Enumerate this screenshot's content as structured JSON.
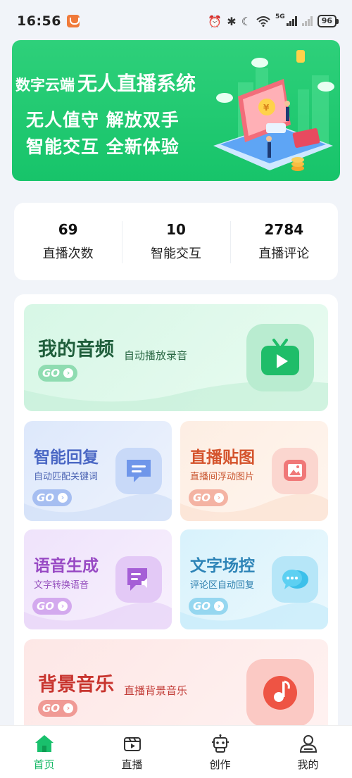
{
  "status_bar": {
    "time": "16:56",
    "network": "5G",
    "battery": "96"
  },
  "banner": {
    "brand": "数字云端",
    "system_name": "无人直播系统",
    "slogan_1": "无人值守 解放双手",
    "slogan_2": "智能交互 全新体验"
  },
  "stats": [
    {
      "value": "69",
      "label": "直播次数"
    },
    {
      "value": "10",
      "label": "智能交互"
    },
    {
      "value": "2784",
      "label": "直播评论"
    }
  ],
  "features": {
    "audio": {
      "title": "我的音频",
      "subtitle": "自动播放录音",
      "go": "GO",
      "color": "#1f7a4c",
      "accent": "#3cc67a"
    },
    "reply": {
      "title": "智能回复",
      "subtitle": "自动匹配关键词",
      "go": "GO",
      "color": "#4a6fd6",
      "accent": "#7aa1f0"
    },
    "sticker": {
      "title": "直播贴图",
      "subtitle": "直播间浮动图片",
      "go": "GO",
      "color": "#d8512f",
      "accent": "#f07f7f"
    },
    "voice": {
      "title": "语音生成",
      "subtitle": "文字转换语音",
      "go": "GO",
      "color": "#9a4dc8",
      "accent": "#b57ee2"
    },
    "text_control": {
      "title": "文字场控",
      "subtitle": "评论区自动回复",
      "go": "GO",
      "color": "#2a86b8",
      "accent": "#4cc3ea"
    },
    "bgm": {
      "title": "背景音乐",
      "subtitle": "直播背景音乐",
      "go": "GO",
      "color": "#d33a35",
      "accent": "#ee5e4c"
    }
  },
  "nav": [
    {
      "label": "首页",
      "icon": "home-icon",
      "active": true
    },
    {
      "label": "直播",
      "icon": "video-icon",
      "active": false
    },
    {
      "label": "创作",
      "icon": "robot-icon",
      "active": false
    },
    {
      "label": "我的",
      "icon": "user-icon",
      "active": false
    }
  ]
}
